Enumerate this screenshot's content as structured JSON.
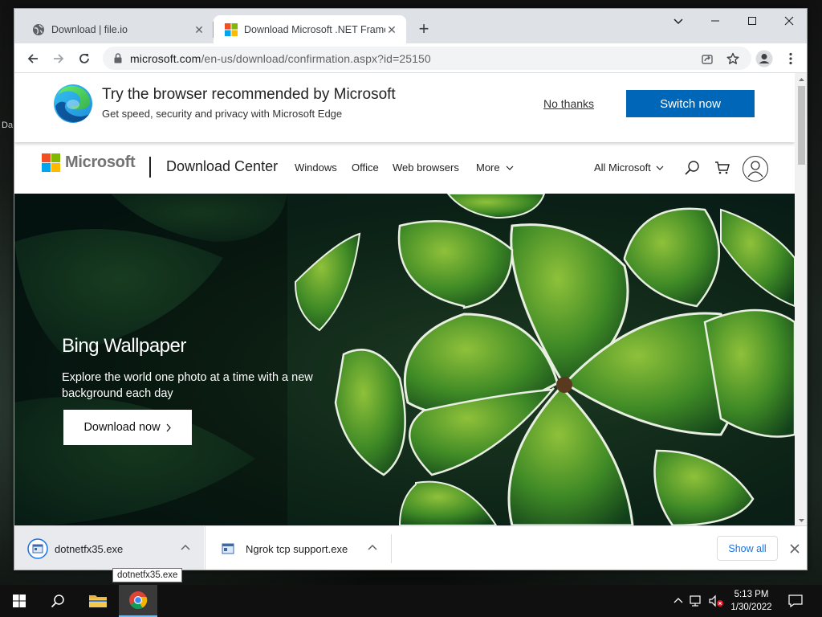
{
  "browser": {
    "tabs": [
      {
        "title": "Download | file.io",
        "active": false
      },
      {
        "title": "Download Microsoft .NET Frame",
        "active": true
      }
    ],
    "address": {
      "host": "microsoft.com",
      "path": "/en-us/download/confirmation.aspx?id=25150"
    }
  },
  "edge_banner": {
    "title": "Try the browser recommended by Microsoft",
    "subtitle": "Get speed, security and privacy with Microsoft Edge",
    "no_thanks": "No thanks",
    "switch_now": "Switch now"
  },
  "header": {
    "brand": "Microsoft",
    "site_title": "Download Center",
    "nav": [
      "Windows",
      "Office",
      "Web browsers",
      "More"
    ],
    "all_microsoft": "All Microsoft"
  },
  "hero": {
    "title": "Bing Wallpaper",
    "description": "Explore the world one photo at a time with a new background each day",
    "button": "Download now"
  },
  "downloads": {
    "items": [
      {
        "name": "dotnetfx35.exe"
      },
      {
        "name": "Ngrok tcp support.exe"
      }
    ],
    "show_all": "Show all",
    "tooltip": "dotnetfx35.exe"
  },
  "taskbar": {
    "time": "5:13 PM",
    "date": "1/30/2022"
  },
  "desktop_fragments": [
    "Da"
  ],
  "colors": {
    "accent": "#0067b8",
    "link_blue": "#1a73e8"
  }
}
